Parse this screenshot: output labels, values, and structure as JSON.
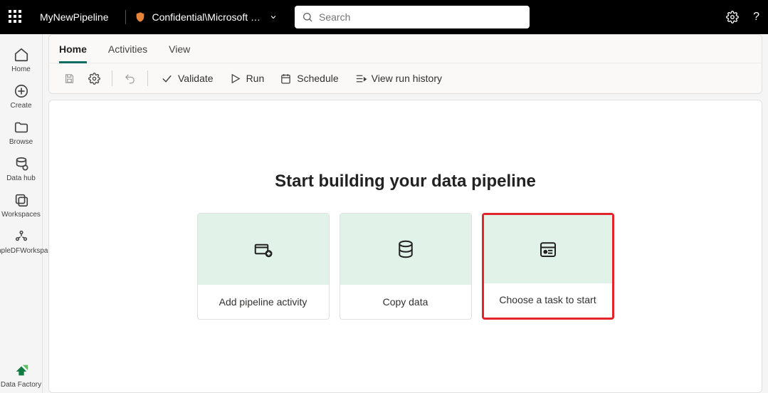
{
  "topbar": {
    "pipeline_name": "MyNewPipeline",
    "confidential_label": "Confidential\\Microsoft …",
    "search_placeholder": "Search"
  },
  "leftnav": {
    "home": "Home",
    "create": "Create",
    "browse": "Browse",
    "datahub": "Data hub",
    "workspaces": "Workspaces",
    "sample_ws": "SampleDFWorkspace",
    "datafactory": "Data Factory"
  },
  "tabs": {
    "home": "Home",
    "activities": "Activities",
    "view": "View"
  },
  "toolbar": {
    "validate": "Validate",
    "run": "Run",
    "schedule": "Schedule",
    "history": "View run history"
  },
  "canvas": {
    "title": "Start building your data pipeline",
    "cards": {
      "add_activity": "Add pipeline activity",
      "copy_data": "Copy data",
      "choose_task": "Choose a task to start"
    }
  }
}
